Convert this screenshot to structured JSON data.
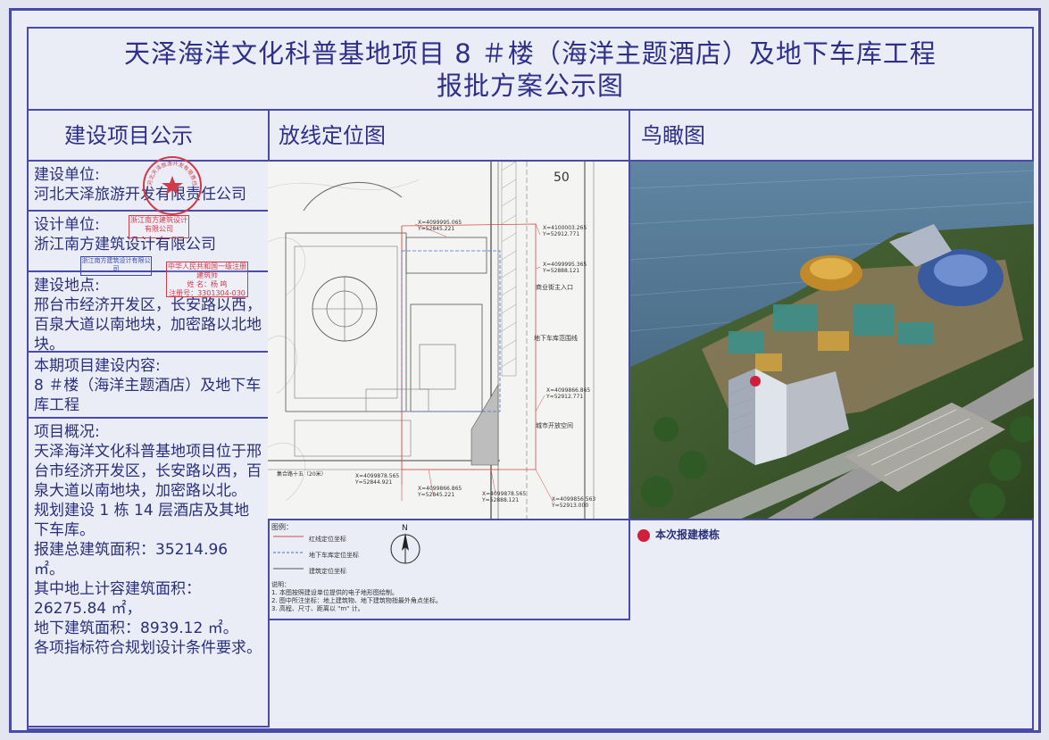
{
  "title": {
    "line1": "天泽海洋文化科普基地项目 8 ＃楼（海洋主题酒店）及地下车库工程",
    "line2": "报批方案公示图"
  },
  "headers": {
    "left": "建设项目公示",
    "middle": "放线定位图",
    "right": "鸟瞰图"
  },
  "left": {
    "builder_label": "建设单位:",
    "builder_value": "河北天泽旅游开发有限责任公司",
    "designer_label": "设计单位:",
    "designer_value": "浙江南方建筑设计有限公司",
    "location_label": "建设地点:",
    "location_value": "邢台市经济开发区，长安路以西，百泉大道以南地块，加密路以北地块。",
    "content_label": "本期项目建设内容:",
    "content_value": "8 ＃楼（海洋主题酒店）及地下车库工程",
    "overview_label": "项目概况:",
    "overview_p1": "天泽海洋文化科普基地项目位于邢台市经济开发区，长安路以西，百泉大道以南地块，加密路以北。",
    "overview_p2": "规划建设 1 栋 14 层酒店及其地下车库。",
    "overview_p3": "报建总建筑面积：35214.96 ㎡。",
    "overview_p4": "其中地上计容建筑面积：26275.84 ㎡，",
    "overview_p5": "地下建筑面积：8939.12 ㎡。",
    "overview_p6": "各项指标符合规划设计条件要求。"
  },
  "stamps": {
    "company_seal": "河北天泽旅游开发有限责任公司",
    "design_seal_1": "浙江南方建筑设计有限公司",
    "design_seal_2": "浙江南方建筑设计有限公司",
    "reg_title": "中华人民共和国一级注册建筑师",
    "reg_name": "姓 名：杨 鸣",
    "reg_no": "注册号：3301304-030"
  },
  "map": {
    "top_label": "50",
    "coords": [
      "X=4099995.065",
      "Y=52845.221",
      "X=4100003.265",
      "Y=52912.771",
      "X=4099995.365",
      "Y=52888.121",
      "X=4099866.865",
      "Y=52912.771",
      "X=4099878.565",
      "Y=52844.921",
      "X=4099866.865",
      "Y=52845.221",
      "X=4099878.565",
      "Y=52888.121",
      "X=4099856.563",
      "Y=52913.000"
    ],
    "labels": {
      "garage_line": "地下车库范围线",
      "open_space": "城市开放空间",
      "entrance": "商业街主入口",
      "road": "集合路十五（20米）",
      "north": "N"
    }
  },
  "legend": {
    "title": "图例：",
    "item1": "红线定位坐标",
    "item2": "地下车库定位坐标",
    "item3": "建筑定位坐标",
    "notes_title": "说明：",
    "note1": "1. 本图按照建设单位提供的电子地形图绘制。",
    "note2": "2. 图中所注坐标：地上建筑物、地下建筑物指最外角点坐标。",
    "note3": "3. 高程、尺寸、距离以 \"m\" 计。"
  },
  "aerial_legend": "本次报建楼栋",
  "colors": {
    "frame": "#4a4aa8",
    "text": "#2a2f7a",
    "stamp": "#d23a4a",
    "highlight_dot": "#d01f3c"
  }
}
